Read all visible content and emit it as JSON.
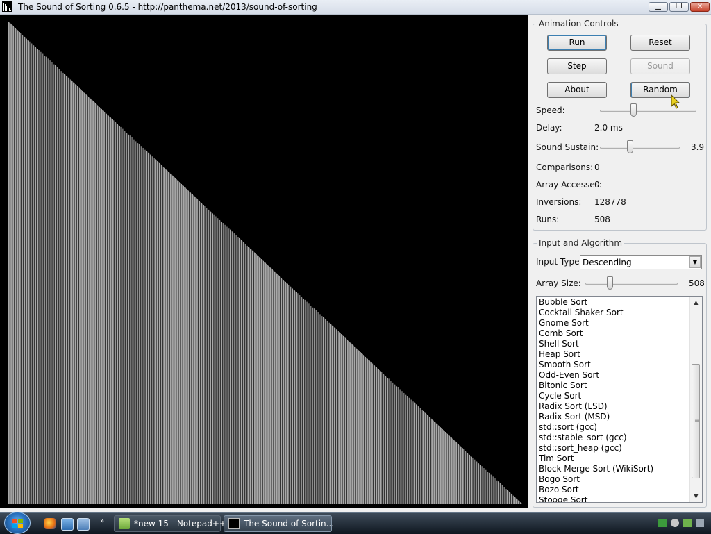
{
  "window": {
    "title": "The Sound of Sorting 0.6.5 - http://panthema.net/2013/sound-of-sorting",
    "controls": {
      "minimize": "▁",
      "maximize": "❐",
      "close": "✕"
    }
  },
  "visualization": {
    "array_size": 508,
    "order": "descending",
    "bar_color": "#ffffff",
    "background_color": "#000000"
  },
  "animation_controls": {
    "legend": "Animation Controls",
    "buttons": {
      "run": "Run",
      "reset": "Reset",
      "step": "Step",
      "sound": "Sound",
      "about": "About",
      "random": "Random"
    },
    "speed_label": "Speed:",
    "speed_value": 0.35,
    "delay_label": "Delay:",
    "delay_value": "2.0 ms",
    "sustain_label": "Sound Sustain:",
    "sustain_value": "3.9",
    "sustain_level": 0.38,
    "comparisons_label": "Comparisons:",
    "comparisons_value": "0",
    "accesses_label": "Array Accesses:",
    "accesses_value": "0",
    "inversions_label": "Inversions:",
    "inversions_value": "128778",
    "runs_label": "Runs:",
    "runs_value": "508"
  },
  "input_algorithm": {
    "legend": "Input and Algorithm",
    "input_type_label": "Input Type:",
    "input_type_value": "Descending",
    "array_size_label": "Array Size:",
    "array_size_value": "508",
    "array_size_level": 0.27,
    "algorithms": [
      "Bubble Sort",
      "Cocktail Shaker Sort",
      "Gnome Sort",
      "Comb Sort",
      "Shell Sort",
      "Heap Sort",
      "Smooth Sort",
      "Odd-Even Sort",
      "Bitonic Sort",
      "Cycle Sort",
      "Radix Sort (LSD)",
      "Radix Sort (MSD)",
      "std::sort (gcc)",
      "std::stable_sort (gcc)",
      "std::sort_heap (gcc)",
      "Tim Sort",
      "Block Merge Sort (WikiSort)",
      "Bogo Sort",
      "Bozo Sort",
      "Stooge Sort"
    ],
    "scroll_up": "▲",
    "scroll_down": "▼",
    "scroll_grip": "≡"
  },
  "taskbar": {
    "more_arrow": "»",
    "tasks": [
      {
        "label": "*new 15 - Notepad++",
        "active": false
      },
      {
        "label": "The Sound of Sortin...",
        "active": true
      }
    ]
  }
}
